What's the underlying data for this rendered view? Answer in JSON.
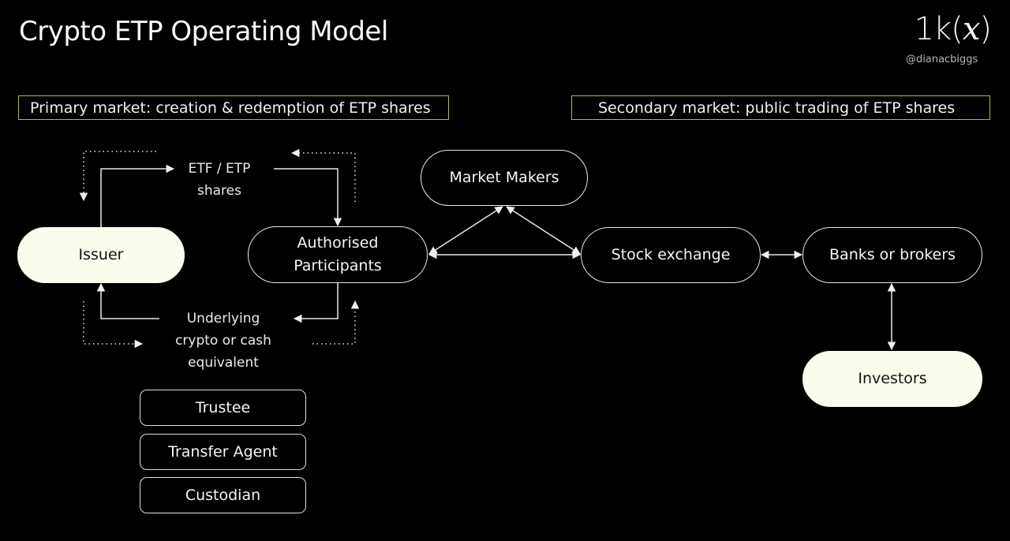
{
  "header": {
    "title": "Crypto ETP Operating Model",
    "logo_prefix": "1k(",
    "logo_x": "x",
    "logo_suffix": ")",
    "handle": "@dianacbiggs"
  },
  "sections": {
    "primary": "Primary market: creation & redemption of ETP shares",
    "secondary": "Secondary market: public trading of ETP shares"
  },
  "nodes": {
    "issuer": "Issuer",
    "ap_line1": "Authorised",
    "ap_line2": "Participants",
    "market_makers": "Market Makers",
    "stock_exchange": "Stock exchange",
    "banks_brokers": "Banks or brokers",
    "investors": "Investors"
  },
  "flow_labels": {
    "shares_line1": "ETF / ETP",
    "shares_line2": "shares",
    "underlying_line1": "Underlying",
    "underlying_line2": "crypto or cash",
    "underlying_line3": "equivalent"
  },
  "service_providers": [
    "Trustee",
    "Transfer Agent",
    "Custodian"
  ],
  "colors": {
    "background": "#000000",
    "section_border": "#b8b54a",
    "filled_node": "#fbfbee",
    "line": "#e8e8e2"
  }
}
